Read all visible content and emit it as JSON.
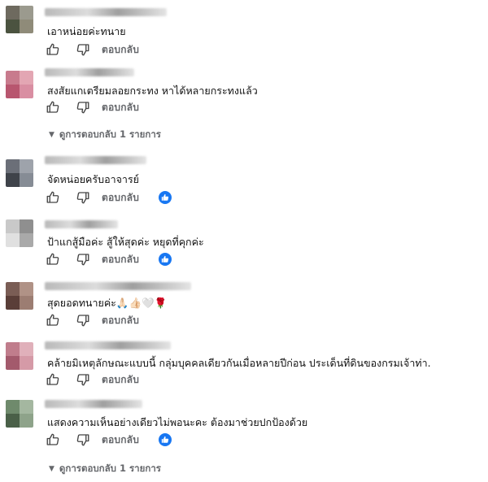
{
  "comments": [
    {
      "text": "เอาหน่อยค่ะทนาย",
      "reply_label": "ตอบกลับ",
      "liked": false,
      "avatar_colors": [
        "#6e6a5f",
        "#9b9a8e",
        "#4b5340",
        "#8f8b79"
      ]
    },
    {
      "text": "สงสัยแกเตรียมลอยกระทง หาได้หลายกระทงแล้ว",
      "reply_label": "ตอบกลับ",
      "liked": false,
      "avatar_colors": [
        "#c87b8d",
        "#e3a6b3",
        "#b8566f",
        "#d98ea2"
      ],
      "view_replies": "ดูการตอบกลับ 1 รายการ"
    },
    {
      "text": "จัดหน่อยครับอาจารย์",
      "reply_label": "ตอบกลับ",
      "liked": true,
      "avatar_colors": [
        "#6b6f78",
        "#9ea3ab",
        "#3f434a",
        "#868c95"
      ]
    },
    {
      "text": "ป้าแกสู้มือค่ะ สู้ให้สุดค่ะ หยุดที่คุกค่ะ",
      "reply_label": "ตอบกลับ",
      "liked": true,
      "avatar_colors": [
        "#c9c9c9",
        "#8f8f8f",
        "#e0e0e0",
        "#a9a9a9"
      ]
    },
    {
      "text": "สุดยอดทนายค่ะ🙏🏻👍🏻🤍🌹",
      "reply_label": "ตอบกลับ",
      "liked": false,
      "avatar_colors": [
        "#7a5d55",
        "#b09286",
        "#5a3e38",
        "#9c7d72"
      ]
    },
    {
      "text": "คล้ายมิเหตุลักษณะแบบนี้ กลุ่มบุคคลเดียวกันเมื่อหลายปีก่อน ประเด็นที่ดินของกรมเจ้าท่า.",
      "reply_label": "ตอบกลับ",
      "liked": false,
      "avatar_colors": [
        "#c07d8c",
        "#e0b0ba",
        "#a35a6c",
        "#d59aa7"
      ]
    },
    {
      "text": "แสดงความเห็นอย่างเดียวไม่พอนะคะ ต้องมาช่วยปกป้องด้วย",
      "reply_label": "ตอบกลับ",
      "liked": true,
      "avatar_colors": [
        "#6f8a6c",
        "#a4b7a0",
        "#4a6048",
        "#8ea38a"
      ],
      "view_replies": "ดูการตอบกลับ 1 รายการ"
    }
  ],
  "colors": {
    "accent": "#1877f2",
    "muted": "#65676b"
  },
  "icons": {
    "like": "thumbs-up-icon",
    "dislike": "thumbs-down-icon",
    "reaction": "like-reaction-icon",
    "expand": "chevron-down-icon"
  }
}
